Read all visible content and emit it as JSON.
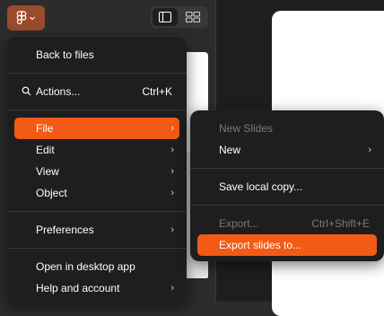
{
  "toolbar": {
    "logo_icon": "figma-logo-icon",
    "logo_chevron": "chevron-down-icon",
    "view_options": [
      "panel-view-icon",
      "grid-view-icon"
    ],
    "accent": "#f25a15",
    "logo_bg": "#9b4a2b"
  },
  "main_menu": {
    "back_to_files": "Back to files",
    "actions": {
      "label": "Actions...",
      "shortcut": "Ctrl+K",
      "icon": "search-icon"
    },
    "file": "File",
    "edit": "Edit",
    "view": "View",
    "object": "Object",
    "preferences": "Preferences",
    "open_desktop": "Open in desktop app",
    "help_account": "Help and account",
    "chevron": "›"
  },
  "file_submenu": {
    "new_slides": "New Slides",
    "new": "New",
    "save_local": "Save local copy...",
    "export": {
      "label": "Export...",
      "shortcut": "Ctrl+Shift+E"
    },
    "export_slides": "Export slides to...",
    "chevron": "›"
  }
}
